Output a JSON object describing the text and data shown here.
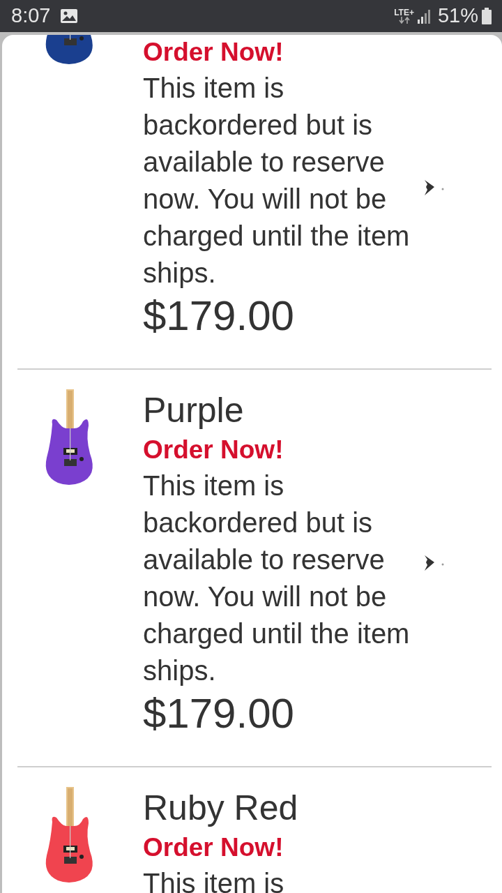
{
  "status_bar": {
    "time": "8:07",
    "network": "LTE+",
    "battery": "51%"
  },
  "products": [
    {
      "order_label": "Order Now!",
      "description": "This item is backordered but is available to reserve now. You will not be charged until the item ships.",
      "price": "$179.00",
      "color": "#1a3f8f"
    },
    {
      "name": "Purple",
      "order_label": "Order Now!",
      "description": "This item is backordered but is available to reserve now. You will not be charged until the item ships.",
      "price": "$179.00",
      "color": "#7a3fcf"
    },
    {
      "name": "Ruby Red",
      "order_label": "Order Now!",
      "description": "This item is",
      "color": "#f0444f"
    }
  ]
}
